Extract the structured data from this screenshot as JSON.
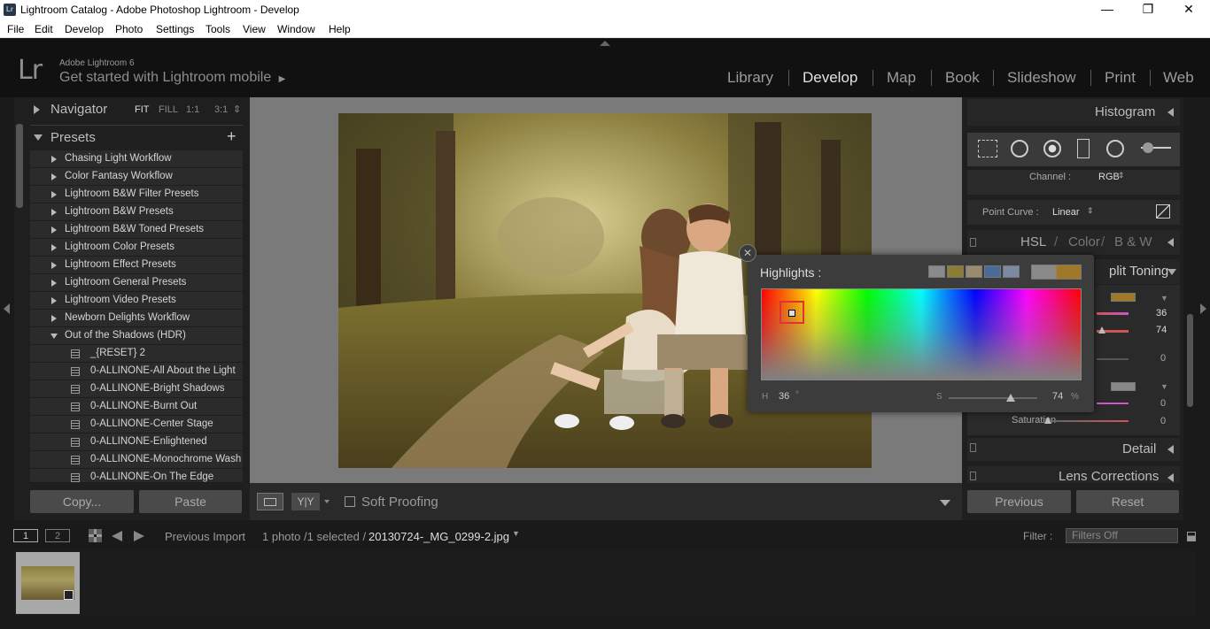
{
  "window": {
    "title": "Lightroom Catalog - Adobe Photoshop Lightroom - Develop",
    "app_icon": "Lr",
    "minimize_glyph": "—",
    "restore_glyph": "❐",
    "close_glyph": "✕"
  },
  "menu": [
    "File",
    "Edit",
    "Develop",
    "Photo",
    "Settings",
    "Tools",
    "View",
    "Window",
    "Help"
  ],
  "identity": {
    "logo": "Lr",
    "line1": "Adobe Lightroom 6",
    "line2": "Get started with Lightroom mobile",
    "arrow": "▶"
  },
  "modules": [
    "Library",
    "Develop",
    "Map",
    "Book",
    "Slideshow",
    "Print",
    "Web"
  ],
  "active_module": "Develop",
  "navigator": {
    "title": "Navigator",
    "zooms": [
      "FIT",
      "FILL",
      "1:1",
      "3:1"
    ],
    "zoom_arrows": "⇕"
  },
  "presets": {
    "title": "Presets",
    "add": "+",
    "folders": [
      "Chasing Light Workflow",
      "Color Fantasy Workflow",
      "Lightroom B&W Filter Presets",
      "Lightroom B&W Presets",
      "Lightroom B&W Toned Presets",
      "Lightroom Color Presets",
      "Lightroom Effect Presets",
      "Lightroom General Presets",
      "Lightroom Video Presets",
      "Newborn Delights Workflow"
    ],
    "open_folder": "Out of the Shadows (HDR)",
    "items": [
      "_{RESET} 2",
      "0-ALLINONE-All About the Light",
      "0-ALLINONE-Bright Shadows",
      "0-ALLINONE-Burnt Out",
      "0-ALLINONE-Center Stage",
      "0-ALLINONE-Enlightened",
      "0-ALLINONE-Monochrome Wash",
      "0-ALLINONE-On The Edge"
    ]
  },
  "left_buttons": {
    "copy": "Copy...",
    "paste": "Paste"
  },
  "toolbar": {
    "yy": "Y|Y",
    "soft_proofing": "Soft Proofing"
  },
  "right_panel": {
    "histogram": "Histogram",
    "channel_label": "Channel :",
    "channel_value": "RGB",
    "point_curve_label": "Point Curve :",
    "point_curve_value": "Linear",
    "hsl": "HSL",
    "color": "Color",
    "bw": "B & W",
    "separator": "/",
    "split_toning": "plit Toning",
    "hue_value": "36",
    "sat_value": "74",
    "balance_value": "0",
    "shadow_hue_value": "0",
    "saturation_label": "Saturation",
    "shadow_sat_value": "0",
    "detail": "Detail",
    "lens_corrections": "Lens Corrections",
    "previous": "Previous",
    "reset": "Reset"
  },
  "picker": {
    "title": "Highlights :",
    "close": "✕",
    "h_label": "H",
    "h_value": "36",
    "h_unit": "°",
    "s_label": "S",
    "s_value": "74",
    "s_unit": "%",
    "swatches": [
      "#8a8a8a",
      "#8c7d35",
      "#9a8a6e",
      "#4a6a9a",
      "#7a8aa0"
    ],
    "current_color": "#a0782a"
  },
  "filmstrip_nav": {
    "screen1": "1",
    "screen2": "2",
    "source": "Previous Import",
    "count": "1 photo /1 selected /",
    "filename": "20130724-_MG_0299-2.jpg",
    "filter_label": "Filter :",
    "filter_value": "Filters Off"
  }
}
